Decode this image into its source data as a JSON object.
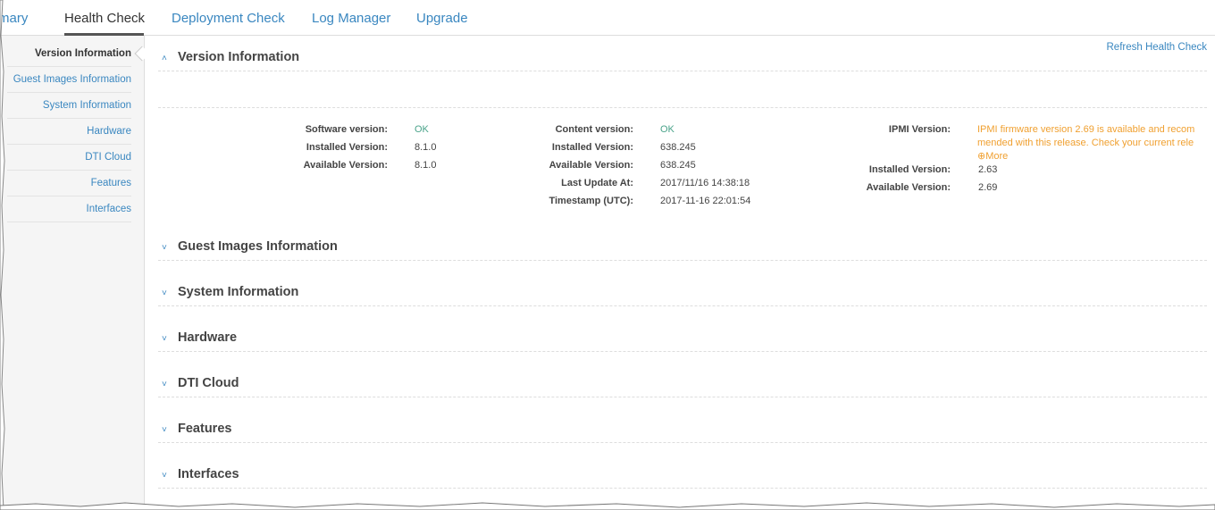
{
  "tabs": [
    {
      "label": "mary"
    },
    {
      "label": "Health Check"
    },
    {
      "label": "Deployment Check"
    },
    {
      "label": "Log Manager"
    },
    {
      "label": "Upgrade"
    }
  ],
  "sidebar": {
    "items": [
      {
        "label": "Version Information"
      },
      {
        "label": "Guest Images Information"
      },
      {
        "label": "System Information"
      },
      {
        "label": "Hardware"
      },
      {
        "label": "DTI Cloud"
      },
      {
        "label": "Features"
      },
      {
        "label": "Interfaces"
      }
    ]
  },
  "refresh_label": "Refresh Health Check",
  "sections": [
    {
      "title": "Version Information",
      "expanded": true
    },
    {
      "title": "Guest Images Information",
      "expanded": false
    },
    {
      "title": "System Information",
      "expanded": false
    },
    {
      "title": "Hardware",
      "expanded": false
    },
    {
      "title": "DTI Cloud",
      "expanded": false
    },
    {
      "title": "Features",
      "expanded": false
    },
    {
      "title": "Interfaces",
      "expanded": false
    }
  ],
  "software": {
    "status_label": "Software version:",
    "status": "OK",
    "installed_label": "Installed Version:",
    "installed": "8.1.0",
    "available_label": "Available Version:",
    "available": "8.1.0"
  },
  "content": {
    "status_label": "Content version:",
    "status": "OK",
    "installed_label": "Installed Version:",
    "installed": "638.245",
    "available_label": "Available Version:",
    "available": "638.245",
    "last_update_label": "Last Update At:",
    "last_update": "2017/11/16 14:38:18",
    "timestamp_label": "Timestamp (UTC):",
    "timestamp": "2017-11-16 22:01:54"
  },
  "ipmi": {
    "label": "IPMI Version:",
    "warning_line1": "IPMI firmware version 2.69 is available and recom",
    "warning_line2": "mended with this release. Check your current rele",
    "more_label": "More",
    "installed_label": "Installed Version:",
    "installed": "2.63",
    "available_label": "Available Version:",
    "available": "2.69"
  },
  "colors": {
    "link": "#3a87c0",
    "ok": "#4aa38a",
    "warning": "#f0a030"
  }
}
